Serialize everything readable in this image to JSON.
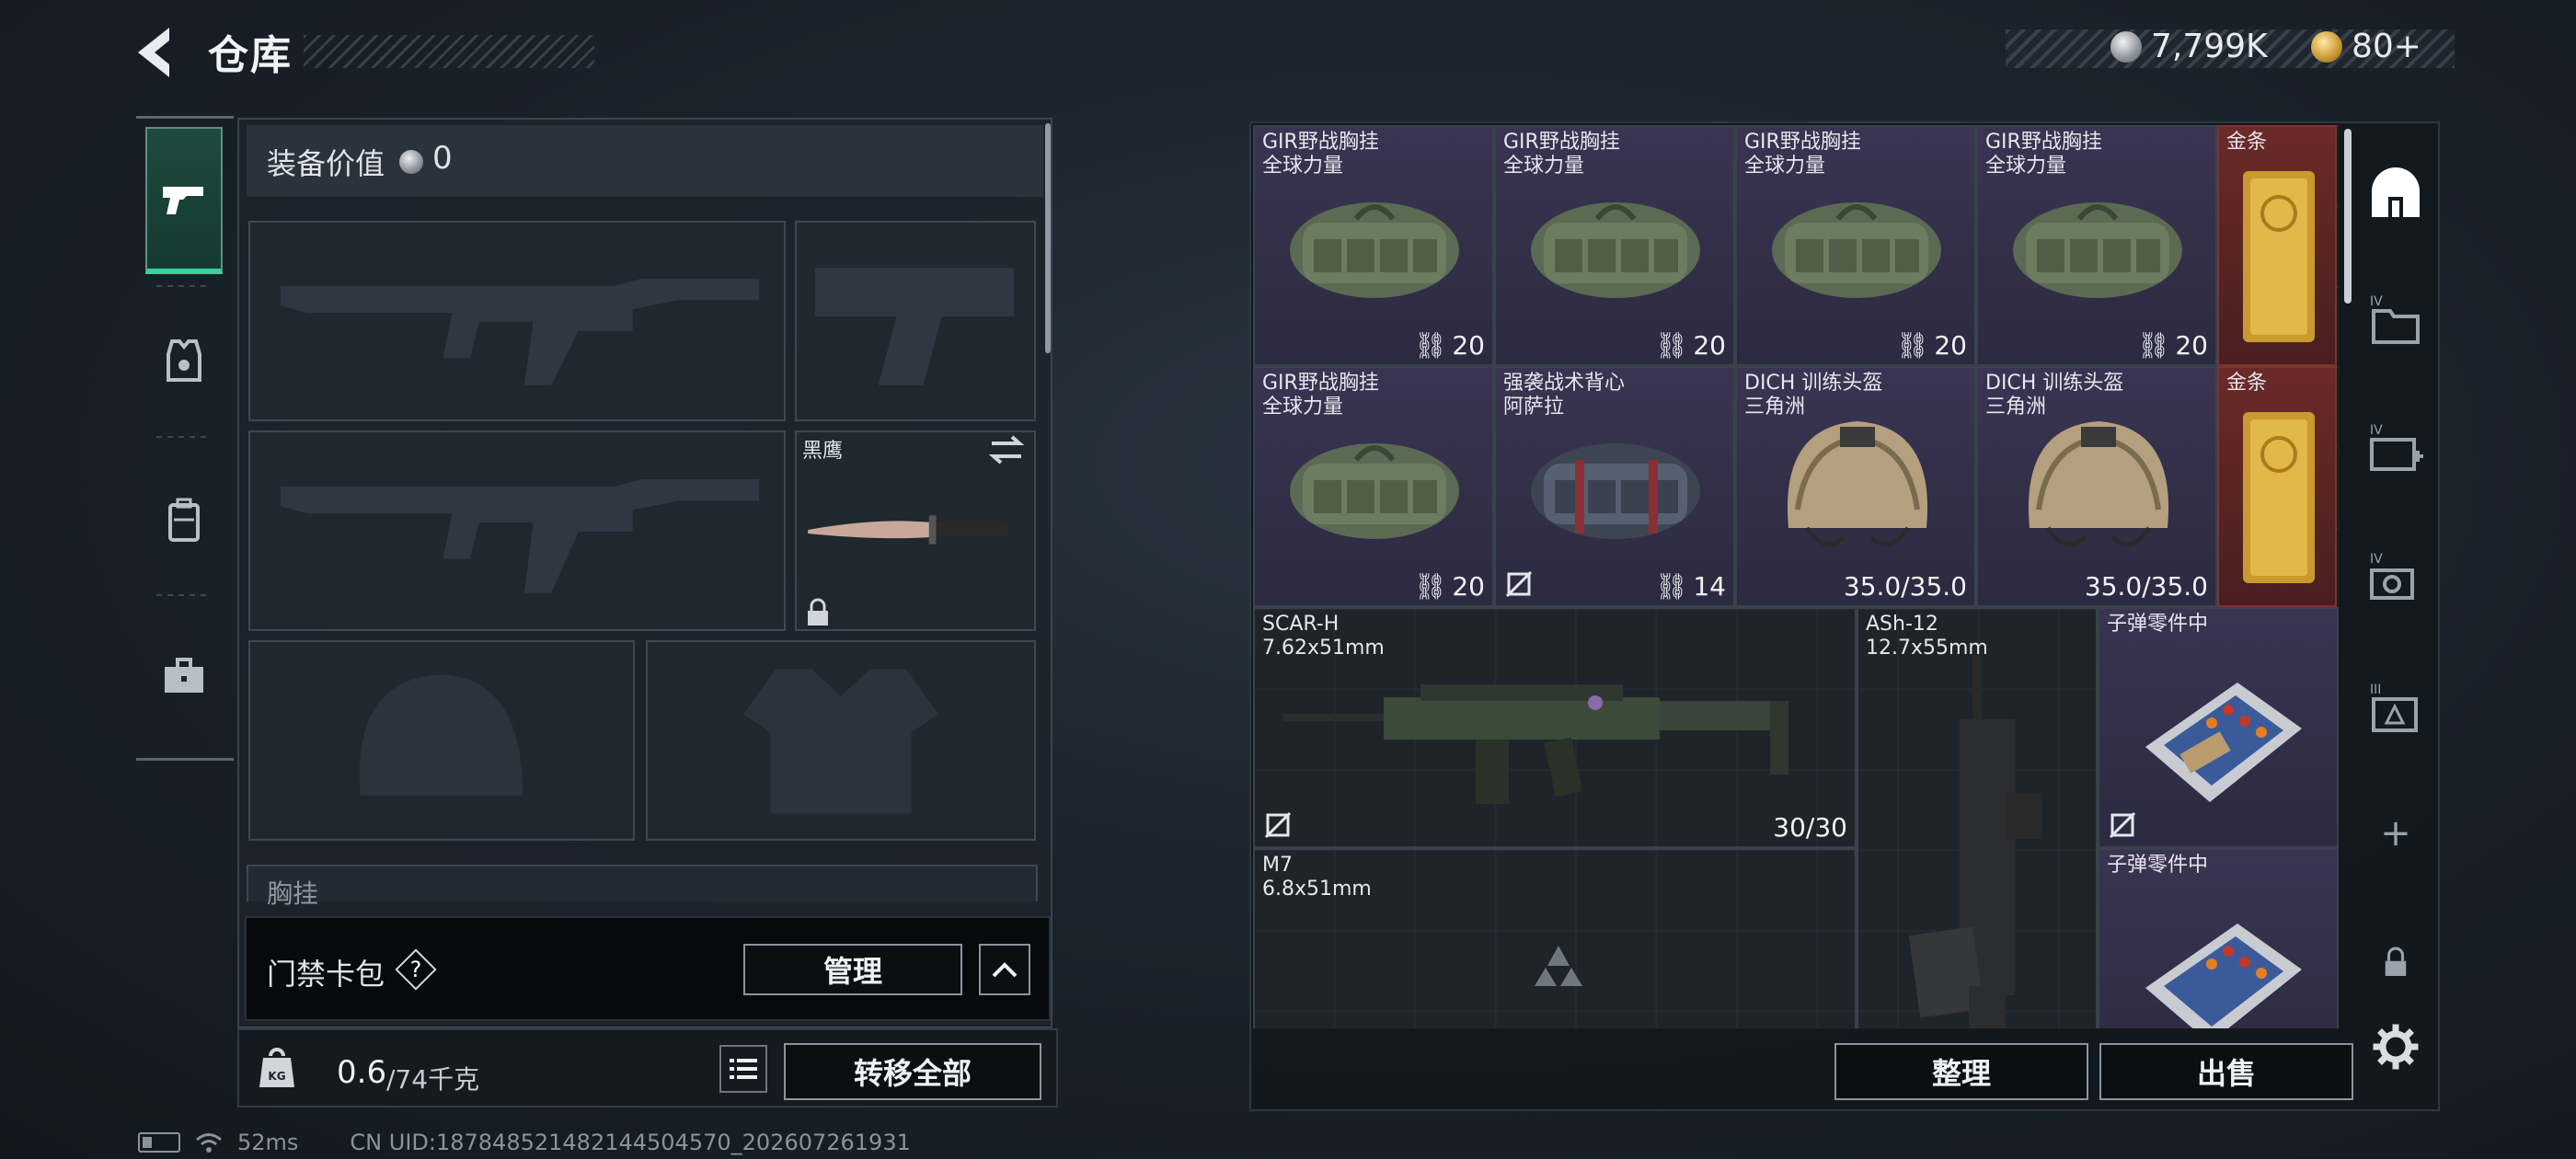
{
  "header": {
    "title": "仓库",
    "silver_amount": "7,799K",
    "gold_amount": "80+"
  },
  "left_tabs": [
    "weapon-tab",
    "equipment-tab",
    "backpack-tab",
    "toolbox-tab"
  ],
  "equipment": {
    "value_label": "装备价值",
    "value": "0",
    "knife_name": "黑鹰",
    "chest_rig_label": "胸挂",
    "chest_rig_help": "?"
  },
  "access_card": {
    "label": "门禁卡包",
    "help": "?",
    "manage_label": "管理"
  },
  "weight": {
    "current": "0.6",
    "max": "/74千克",
    "transfer_all_label": "转移全部"
  },
  "status_bar": {
    "ping": "52ms",
    "uid": "CN UID:187848521482144504570_202607261931"
  },
  "storage": {
    "items": [
      {
        "name1": "GIR野战胸挂",
        "name2": "全球力量",
        "qty": "20"
      },
      {
        "name1": "GIR野战胸挂",
        "name2": "全球力量",
        "qty": "20"
      },
      {
        "name1": "GIR野战胸挂",
        "name2": "全球力量",
        "qty": "20"
      },
      {
        "name1": "GIR野战胸挂",
        "name2": "全球力量",
        "qty": "20"
      },
      {
        "name1": "金条",
        "name2": ""
      },
      {
        "name1": "GIR野战胸挂",
        "name2": "全球力量",
        "qty": "20"
      },
      {
        "name1": "强袭战术背心",
        "name2": "阿萨拉",
        "qty": "14"
      },
      {
        "name1": "DICH 训练头盔",
        "name2": "三角洲",
        "qty": "35.0/35.0"
      },
      {
        "name1": "DICH 训练头盔",
        "name2": "三角洲",
        "qty": "35.0/35.0"
      },
      {
        "name1": "金条",
        "name2": ""
      },
      {
        "name1": "SCAR-H",
        "name2": "7.62x51mm",
        "qty": "30/30"
      },
      {
        "name1": "ASh-12",
        "name2": "12.7x55mm"
      },
      {
        "name1": "子弹零件中",
        "name2": ""
      },
      {
        "name1": "M7",
        "name2": "6.8x51mm"
      },
      {
        "name1": "子弹零件中",
        "name2": ""
      }
    ],
    "sort_label": "整理",
    "sell_label": "出售"
  },
  "right_tabs": {
    "icons": [
      "home-icon",
      "folder-iv-icon",
      "medkit-iv-icon",
      "camera-iv-icon",
      "crate-iii-icon",
      "add-icon",
      "lock-icon",
      "gear-icon"
    ],
    "add_label": "+"
  },
  "colors": {
    "accent_green": "#37d39a",
    "rare_purple": "#3a3452",
    "legendary_red": "#6a2a28"
  }
}
